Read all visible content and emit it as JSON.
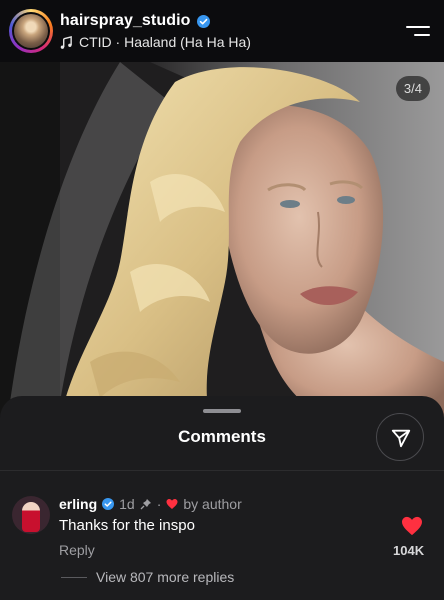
{
  "header": {
    "username": "hairspray_studio",
    "audio": "CTID · Haaland (Ha Ha Ha)"
  },
  "photo": {
    "counter": "3/4"
  },
  "comments_sheet": {
    "title": "Comments",
    "comment": {
      "username": "erling",
      "time": "1d",
      "separator": "·",
      "author_like": "by author",
      "text": "Thanks for the inspo",
      "reply_label": "Reply",
      "like_count": "104K",
      "view_replies": "View 807 more replies"
    }
  },
  "colors": {
    "like_red": "#ff3040",
    "verified_blue": "#3897f0",
    "sheet_bg": "#1c1c1e"
  }
}
